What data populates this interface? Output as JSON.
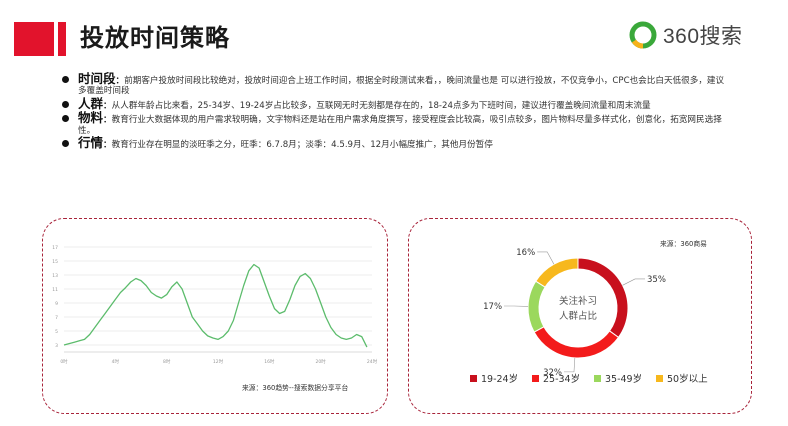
{
  "page": {
    "title": "投放时间策略"
  },
  "logo": {
    "text": "360搜索",
    "colors": {
      "ring": "#3aa83a",
      "accent": "#f6b21a"
    }
  },
  "bullets": [
    {
      "head": "时间段",
      "text": "前期客户投放时间段比较绝对，投放时间迎合上班工作时间，根据全时段测试来看，，晚间流量也是 可以进行投放，不仅竞争小，CPC也会比白天低很多，建议多覆盖时间段"
    },
    {
      "head": "人群",
      "text": "从人群年龄占比来看，25-34岁、19-24岁占比较多，互联网无时无刻都是存在的，18-24点多为下班时间，建议进行覆盖晚间流量和周末流量"
    },
    {
      "head": "物料",
      "text": "教育行业大数据体现的用户需求较明确，文字物料还是站在用户需求角度撰写，接受程度会比较高，吸引点较多，图片物料尽量多样式化，创意化，拓宽网民选择性。"
    },
    {
      "head": "行情",
      "text": "教育行业存在明显的淡旺季之分，旺季：6.7.8月；淡季：4.5.9月、12月小幅度推广，其他月份暂停"
    }
  ],
  "chart_data": [
    {
      "type": "line",
      "source": "来源：360趋势--搜索数据分享平台",
      "x": [
        0,
        0.4,
        0.8,
        1.2,
        1.6,
        2,
        2.4,
        2.8,
        3.2,
        3.6,
        4,
        4.4,
        4.8,
        5.2,
        5.6,
        6,
        6.4,
        6.8,
        7.2,
        7.6,
        8,
        8.4,
        8.8,
        9.2,
        9.6,
        10,
        10.4,
        10.8,
        11.2,
        11.6,
        12,
        12.4,
        12.8,
        13.2,
        13.6,
        14,
        14.4,
        14.8,
        15.2,
        15.6,
        16,
        16.4,
        16.8,
        17.2,
        17.6,
        18,
        18.4,
        18.8,
        19.2,
        19.6,
        20,
        20.4,
        20.8,
        21.2,
        21.6,
        22,
        22.4,
        22.8,
        23.2,
        23.6
      ],
      "values": [
        3,
        3.2,
        3.4,
        3.6,
        3.8,
        4.5,
        5.5,
        6.5,
        7.5,
        8.5,
        9.5,
        10.5,
        11.2,
        12,
        12.5,
        12.2,
        11.5,
        10.5,
        10,
        9.7,
        10.2,
        11.3,
        12,
        11,
        9,
        7,
        6,
        5,
        4.3,
        4,
        3.8,
        4.2,
        5,
        6.5,
        9,
        11.5,
        13.6,
        14.5,
        14,
        12,
        10,
        8.2,
        7.5,
        7.8,
        9.5,
        11.5,
        12.8,
        13.2,
        12.5,
        11,
        9,
        7,
        5.5,
        4.5,
        4,
        3.8,
        4,
        4.5,
        4.2,
        2.7
      ],
      "ylim": [
        2,
        17
      ],
      "ytick_labels": [
        "3",
        "5",
        "7",
        "9",
        "11",
        "13",
        "15",
        "17"
      ],
      "xtick_labels": [
        "0时",
        "4时",
        "8时",
        "12时",
        "16时",
        "20时",
        "24时"
      ],
      "grid": true,
      "colors": {
        "line": "#5cbc6c",
        "grid": "#e8e8e8"
      }
    },
    {
      "type": "pie",
      "title": "",
      "source": "来源：360商易",
      "center_text": [
        "关注补习",
        "人群占比"
      ],
      "series": [
        {
          "name": "19-24岁",
          "value": 35,
          "label": "35%",
          "color": "#c8101d"
        },
        {
          "name": "25-34岁",
          "value": 32,
          "label": "32%",
          "color": "#f31b1b"
        },
        {
          "name": "35-49岁",
          "value": 17,
          "label": "17%",
          "color": "#9bd85d"
        },
        {
          "name": "50岁以上",
          "value": 16,
          "label": "16%",
          "color": "#f7b81d"
        }
      ],
      "legend": "bottom"
    }
  ]
}
